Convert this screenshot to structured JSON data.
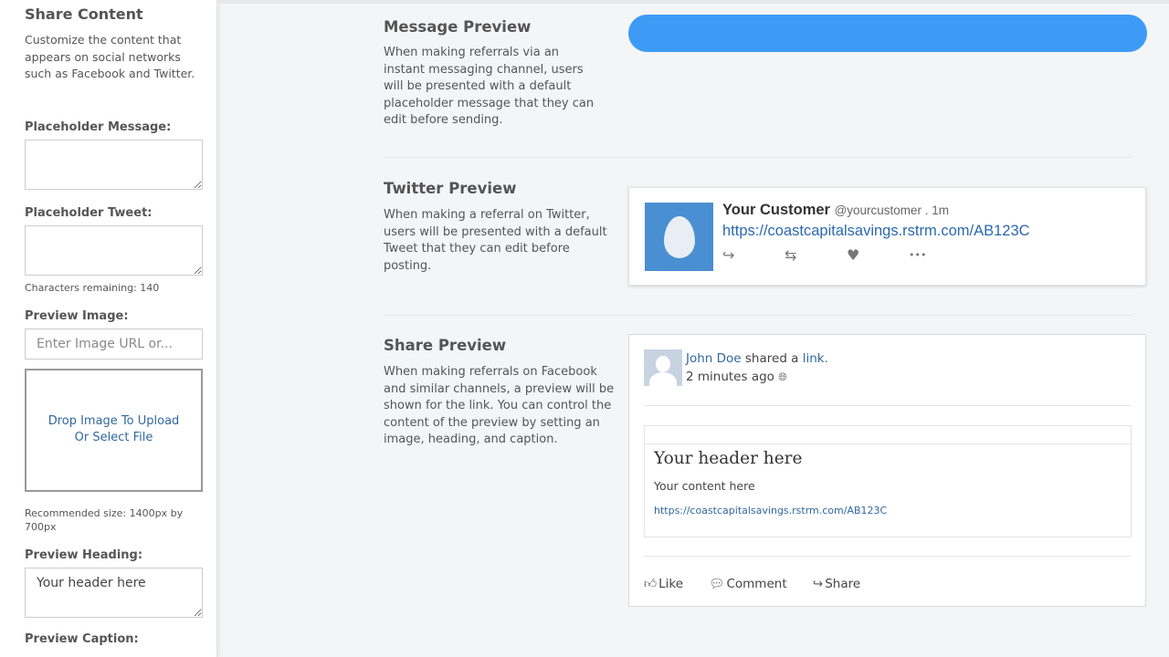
{
  "sidebar": {
    "title": "Share Content",
    "description": "Customize the content that appears on social networks such as Facebook and Twitter.",
    "placeholder_message_label": "Placeholder Message:",
    "placeholder_message_value": "",
    "placeholder_tweet_label": "Placeholder Tweet:",
    "placeholder_tweet_value": "",
    "characters_remaining": "Characters remaining: 140",
    "preview_image_label": "Preview Image:",
    "image_url_placeholder": "Enter Image URL or...",
    "dropzone_line1": "Drop Image To Upload",
    "dropzone_line2": "Or Select File",
    "recommended_size": "Recommended size: 1400px by 700px",
    "preview_heading_label": "Preview Heading:",
    "preview_heading_value": "Your header here",
    "preview_caption_label": "Preview Caption:"
  },
  "message_preview": {
    "title": "Message Preview",
    "description": "When making referrals via an instant messaging channel, users will be presented with a default placeholder message that they can edit before sending.",
    "bubble_color": "#3d9bf5"
  },
  "twitter_preview": {
    "title": "Twitter Preview",
    "description": "When making a referral on Twitter, users will be presented with a default Tweet that they can edit before posting.",
    "name": "Your Customer",
    "handle": "@yourcustomer . 1m",
    "link": "https://coastcapitalsavings.rstrm.com/AB123C",
    "actions": [
      {
        "name": "reply-icon",
        "glyph": "↪"
      },
      {
        "name": "retweet-icon",
        "glyph": "⇆"
      },
      {
        "name": "heart-icon",
        "glyph": "♥"
      },
      {
        "name": "more-icon",
        "glyph": "•••"
      }
    ]
  },
  "share_preview": {
    "title": "Share Preview",
    "description": "When making referrals on Facebook and similar channels, a preview will be shown for the link. You can control the content of the preview by setting an image, heading, and caption.",
    "user": "John Doe",
    "shared_text": " shared a ",
    "link_word": "link.",
    "time": "2 minutes ago",
    "heading": "Your header here",
    "content": "Your content here",
    "link": "https://coastcapitalsavings.rstrm.com/AB123C",
    "actions": {
      "like": "Like",
      "comment": "Comment",
      "share": "Share"
    }
  }
}
